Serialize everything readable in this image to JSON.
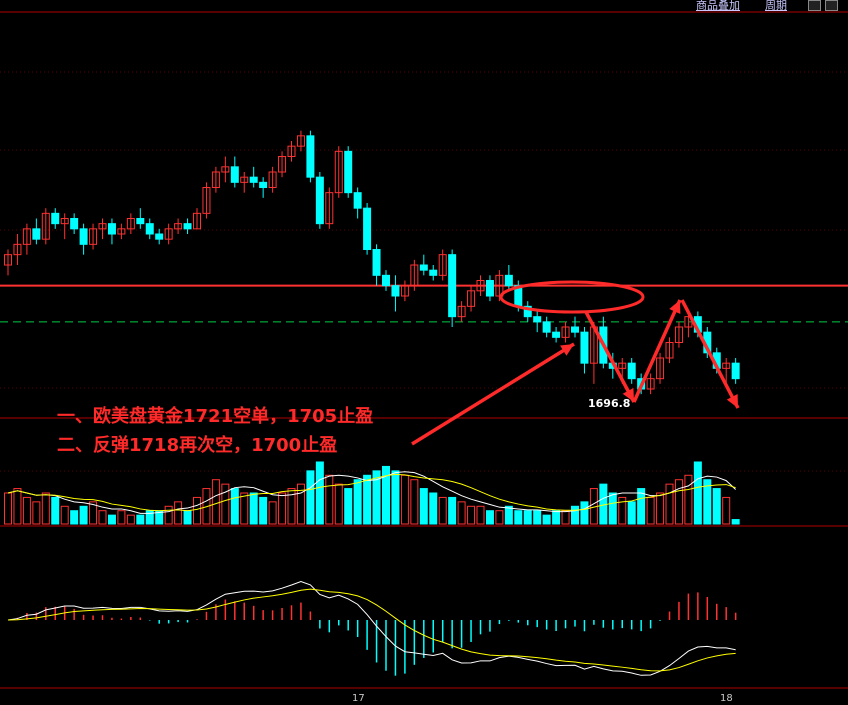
{
  "toolbar": {
    "items": [
      "商品叠加",
      "周期"
    ]
  },
  "annotations": {
    "line1": "一、欧美盘黄金1721空单，1705止盈",
    "line2": "二、反弹1718再次空，1700止盈",
    "low_label": "1696.8"
  },
  "colors": {
    "background": "#000000",
    "up": "#ff3232",
    "down": "#00ffff",
    "ma_white": "#ffffff",
    "ma_yellow": "#ffff00",
    "annotation": "#ff2a2a",
    "support_line": "#00cc44",
    "separator": "#b00000"
  },
  "chart_data": [
    {
      "type": "candlestick",
      "name": "price",
      "x_labels": [
        "17",
        "18"
      ],
      "resistance": 1718,
      "support": 1711,
      "low_marker": 1696.8,
      "ylim": [
        1692,
        1752
      ],
      "ohlc": [
        [
          1722,
          1725,
          1720,
          1724
        ],
        [
          1724,
          1728,
          1722,
          1726
        ],
        [
          1726,
          1730,
          1724,
          1729
        ],
        [
          1729,
          1731,
          1726,
          1727
        ],
        [
          1727,
          1733,
          1726,
          1732
        ],
        [
          1732,
          1733,
          1729,
          1730
        ],
        [
          1730,
          1732,
          1727,
          1731
        ],
        [
          1731,
          1732,
          1728,
          1729
        ],
        [
          1729,
          1730,
          1724,
          1726
        ],
        [
          1726,
          1730,
          1725,
          1729
        ],
        [
          1729,
          1731,
          1727,
          1730
        ],
        [
          1730,
          1731,
          1726,
          1728
        ],
        [
          1728,
          1730,
          1727,
          1729
        ],
        [
          1729,
          1732,
          1728,
          1731
        ],
        [
          1731,
          1733,
          1729,
          1730
        ],
        [
          1730,
          1731,
          1727,
          1728
        ],
        [
          1728,
          1729,
          1726,
          1727
        ],
        [
          1727,
          1730,
          1726,
          1729
        ],
        [
          1729,
          1731,
          1728,
          1730
        ],
        [
          1730,
          1731,
          1728,
          1729
        ],
        [
          1729,
          1733,
          1729,
          1732
        ],
        [
          1732,
          1738,
          1731,
          1737
        ],
        [
          1737,
          1741,
          1736,
          1740
        ],
        [
          1740,
          1743,
          1738,
          1741
        ],
        [
          1741,
          1743,
          1737,
          1738
        ],
        [
          1738,
          1740,
          1736,
          1739
        ],
        [
          1739,
          1741,
          1737,
          1738
        ],
        [
          1738,
          1739,
          1735,
          1737
        ],
        [
          1737,
          1741,
          1736,
          1740
        ],
        [
          1740,
          1744,
          1739,
          1743
        ],
        [
          1743,
          1746,
          1742,
          1745
        ],
        [
          1745,
          1748,
          1744,
          1747
        ],
        [
          1747,
          1748,
          1738,
          1739
        ],
        [
          1739,
          1740,
          1729,
          1730
        ],
        [
          1730,
          1737,
          1729,
          1736
        ],
        [
          1736,
          1745,
          1735,
          1744
        ],
        [
          1744,
          1745,
          1735,
          1736
        ],
        [
          1736,
          1737,
          1731,
          1733
        ],
        [
          1733,
          1734,
          1724,
          1725
        ],
        [
          1725,
          1726,
          1718,
          1720
        ],
        [
          1720,
          1721,
          1717,
          1718
        ],
        [
          1718,
          1720,
          1713,
          1716
        ],
        [
          1716,
          1719,
          1715,
          1718
        ],
        [
          1718,
          1723,
          1717,
          1722
        ],
        [
          1722,
          1724,
          1720,
          1721
        ],
        [
          1721,
          1722,
          1719,
          1720
        ],
        [
          1720,
          1725,
          1719,
          1724
        ],
        [
          1724,
          1725,
          1710,
          1712
        ],
        [
          1712,
          1715,
          1711,
          1714
        ],
        [
          1714,
          1718,
          1713,
          1717
        ],
        [
          1717,
          1720,
          1716,
          1719
        ],
        [
          1719,
          1720,
          1715,
          1716
        ],
        [
          1716,
          1721,
          1715,
          1720
        ],
        [
          1720,
          1722,
          1717,
          1718
        ],
        [
          1718,
          1719,
          1713,
          1714
        ],
        [
          1714,
          1715,
          1711,
          1712
        ],
        [
          1712,
          1713,
          1709,
          1711
        ],
        [
          1711,
          1712,
          1708,
          1709
        ],
        [
          1709,
          1710,
          1707,
          1708
        ],
        [
          1708,
          1711,
          1707,
          1710
        ],
        [
          1710,
          1712,
          1708,
          1709
        ],
        [
          1709,
          1710,
          1701,
          1703
        ],
        [
          1703,
          1711,
          1699,
          1710
        ],
        [
          1710,
          1712,
          1702,
          1703
        ],
        [
          1703,
          1705,
          1700,
          1702
        ],
        [
          1702,
          1704,
          1699,
          1703
        ],
        [
          1703,
          1704,
          1699,
          1700
        ],
        [
          1700,
          1701,
          1697,
          1698
        ],
        [
          1698,
          1701,
          1697,
          1700
        ],
        [
          1700,
          1705,
          1699,
          1704
        ],
        [
          1704,
          1708,
          1703,
          1707
        ],
        [
          1707,
          1711,
          1706,
          1710
        ],
        [
          1710,
          1713,
          1708,
          1712
        ],
        [
          1712,
          1713,
          1708,
          1709
        ],
        [
          1709,
          1710,
          1704,
          1705
        ],
        [
          1705,
          1706,
          1701,
          1702
        ],
        [
          1702,
          1704,
          1699,
          1703
        ],
        [
          1703,
          1704,
          1699,
          1700
        ]
      ]
    },
    {
      "type": "bar",
      "name": "volume",
      "values": [
        7,
        8,
        6,
        5,
        7,
        6,
        4,
        3,
        4,
        5,
        3,
        2,
        3,
        2,
        2,
        3,
        3,
        4,
        5,
        3,
        6,
        8,
        10,
        9,
        8,
        7,
        7,
        6,
        5,
        7,
        8,
        9,
        12,
        14,
        11,
        9,
        8,
        10,
        11,
        12,
        13,
        12,
        11,
        10,
        8,
        7,
        6,
        6,
        5,
        4,
        4,
        3,
        3,
        4,
        3,
        3,
        3,
        2,
        3,
        3,
        4,
        5,
        8,
        9,
        7,
        6,
        5,
        8,
        6,
        7,
        9,
        10,
        11,
        14,
        10,
        8,
        6,
        1
      ],
      "up": [
        1,
        1,
        1,
        1,
        1,
        0,
        1,
        0,
        0,
        1,
        1,
        0,
        1,
        1,
        0,
        0,
        0,
        1,
        1,
        0,
        1,
        1,
        1,
        1,
        0,
        1,
        0,
        0,
        1,
        1,
        1,
        1,
        0,
        0,
        1,
        1,
        0,
        0,
        0,
        0,
        0,
        0,
        1,
        1,
        0,
        0,
        1,
        0,
        1,
        1,
        1,
        0,
        1,
        0,
        0,
        0,
        0,
        0,
        0,
        1,
        0,
        0,
        1,
        0,
        0,
        1,
        0,
        0,
        1,
        1,
        1,
        1,
        1,
        0,
        0,
        0,
        1,
        0
      ]
    },
    {
      "type": "line",
      "name": "macd",
      "histogram_zero": "center"
    }
  ]
}
